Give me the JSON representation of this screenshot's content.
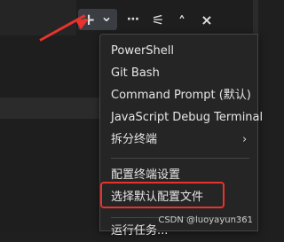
{
  "toolbar": {
    "new_terminal_icon": "+",
    "launch_profile_icon": "⌄",
    "more_actions_icon": "⋯",
    "split_icon": "⚟",
    "maximize_icon": "˄",
    "close_icon": "×"
  },
  "menu": {
    "items": [
      {
        "label": "PowerShell"
      },
      {
        "label": "Git Bash"
      },
      {
        "label": "Command Prompt (默认)"
      },
      {
        "label": "JavaScript Debug Terminal"
      },
      {
        "label": "拆分终端",
        "submenu": "›"
      },
      {
        "label": "配置终端设置"
      },
      {
        "label": "选择默认配置文件"
      },
      {
        "label": "运行任务..."
      }
    ]
  },
  "watermark": "CSDN @luoyayun361",
  "colors": {
    "annotation": "#e8322d",
    "menu_bg": "#252526"
  }
}
